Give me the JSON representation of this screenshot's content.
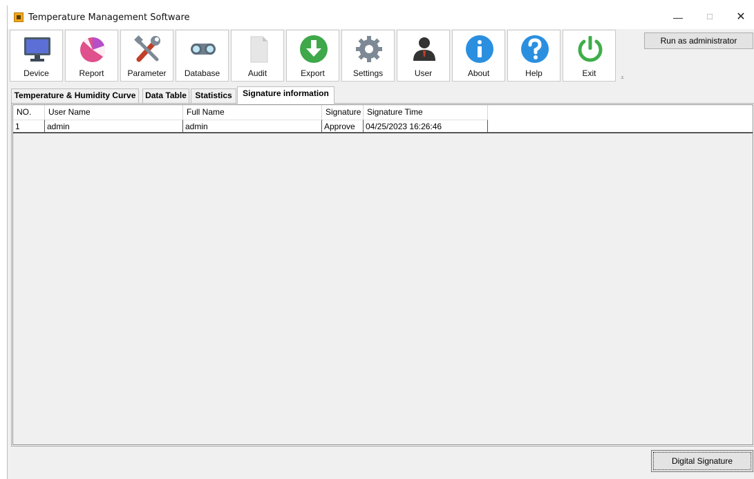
{
  "window": {
    "title": "Temperature Management Software",
    "controls": {
      "minimize": "—",
      "maximize": "☐",
      "close": "✕"
    }
  },
  "toolbar": {
    "items": [
      {
        "label": "Device",
        "icon": "monitor-icon"
      },
      {
        "label": "Report",
        "icon": "pie-chart-icon"
      },
      {
        "label": "Parameter",
        "icon": "tools-icon"
      },
      {
        "label": "Database",
        "icon": "binoculars-icon"
      },
      {
        "label": "Audit",
        "icon": "document-icon"
      },
      {
        "label": "Export",
        "icon": "download-icon"
      },
      {
        "label": "Settings",
        "icon": "gear-icon"
      },
      {
        "label": "User",
        "icon": "user-icon"
      },
      {
        "label": "About",
        "icon": "info-icon"
      },
      {
        "label": "Help",
        "icon": "help-icon"
      },
      {
        "label": "Exit",
        "icon": "power-icon"
      }
    ],
    "overflow": "⩡",
    "admin_button": "Run as administrator"
  },
  "tabs": [
    {
      "label": "Temperature & Humidity Curve",
      "active": false
    },
    {
      "label": "Data Table",
      "active": false
    },
    {
      "label": "Statistics",
      "active": false
    },
    {
      "label": "Signature information",
      "active": true
    }
  ],
  "table": {
    "columns": [
      "NO.",
      "User Name",
      "Full Name",
      "Signature",
      "Signature Time"
    ],
    "rows": [
      [
        "1",
        "admin",
        "admin",
        "Approve",
        "04/25/2023 16:26:46"
      ]
    ]
  },
  "footer": {
    "digital_signature_button": "Digital Signature"
  },
  "colors": {
    "device": "#5b6fd6",
    "report": "#e0508c",
    "parameter": "#c0402a",
    "database": "#7a8c99",
    "audit": "#e8e8e8",
    "export": "#3ea84a",
    "settings": "#7d8a96",
    "user": "#333333",
    "about": "#2b8fe0",
    "help": "#2b8fe0",
    "exit": "#3fae49"
  }
}
